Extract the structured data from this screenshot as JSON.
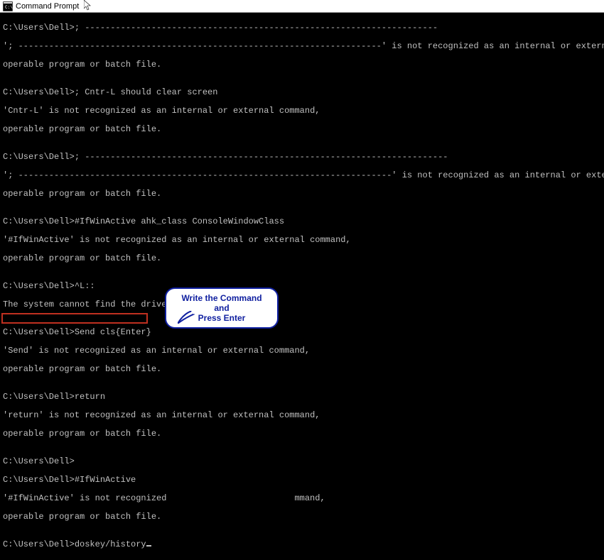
{
  "window": {
    "title": "Command Prompt"
  },
  "prompt": "C:\\Users\\Dell>",
  "lines": {
    "l1": "C:\\Users\\Dell>; ---------------------------------------------------------------------",
    "l2": "'; -----------------------------------------------------------------------' is not recognized as an internal or external command,",
    "l3": "operable program or batch file.",
    "l4": "",
    "l5": "C:\\Users\\Dell>; Cntr-L should clear screen",
    "l6": "'Cntr-L' is not recognized as an internal or external command,",
    "l7": "operable program or batch file.",
    "l8": "",
    "l9": "C:\\Users\\Dell>; -----------------------------------------------------------------------",
    "l10": "'; -------------------------------------------------------------------------' is not recognized as an internal or external command,",
    "l11": "operable program or batch file.",
    "l12": "",
    "l13": "C:\\Users\\Dell>#IfWinActive ahk_class ConsoleWindowClass",
    "l14": "'#IfWinActive' is not recognized as an internal or external command,",
    "l15": "operable program or batch file.",
    "l16": "",
    "l17": "C:\\Users\\Dell>^L::",
    "l18": "The system cannot find the drive specified.",
    "l19": "",
    "l20": "C:\\Users\\Dell>Send cls{Enter}",
    "l21": "'Send' is not recognized as an internal or external command,",
    "l22": "operable program or batch file.",
    "l23": "",
    "l24": "C:\\Users\\Dell>return",
    "l25": "'return' is not recognized as an internal or external command,",
    "l26": "operable program or batch file.",
    "l27": "",
    "l28": "C:\\Users\\Dell>",
    "l29": "C:\\Users\\Dell>#IfWinActive",
    "l30a": "'#IfWinActive' is not recognized",
    "l30b": "mmand,",
    "l31": "operable program or batch file.",
    "l32": "",
    "l33": "C:\\Users\\Dell>doskey/history"
  },
  "callout": {
    "line1": "Write the Command and",
    "line2": "Press Enter"
  },
  "current_command": "doskey/history"
}
